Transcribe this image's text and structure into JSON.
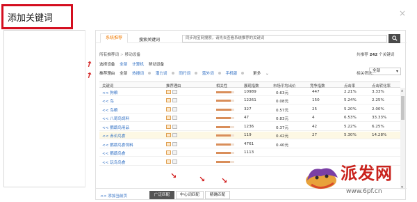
{
  "dialog": {
    "title": "添加关键词",
    "close_glyph": "×"
  },
  "tabs": [
    {
      "label": "系统推荐",
      "active": true
    },
    {
      "label": "搜索关键词",
      "active": false
    }
  ],
  "search": {
    "placeholder": "同步淘宝网搜索，请先去查看系统推荐的关键词",
    "button_icon": "search-icon"
  },
  "breadcrumb": {
    "root": "所有推荐词",
    "current": "移动设备"
  },
  "total_text": {
    "prefix": "共推荐",
    "count": "242",
    "suffix": "个关键词"
  },
  "filters": {
    "device_label": "选择设备",
    "device_options": [
      "全部",
      "计算机",
      "移动设备"
    ],
    "reason_label": "推荐理由",
    "reason_options": [
      "全部",
      "热搜词",
      "潜力词",
      "同行词",
      "蓝外词",
      "手机版"
    ],
    "more_label": "更多",
    "relevance_label": "相关筛选：",
    "relevance_value": "全部"
  },
  "table": {
    "headers": [
      "关键词",
      "推荐理由",
      "相关性",
      "展现指数",
      "市场平均出价",
      "竞争指数",
      "点击率",
      "点击转化率"
    ],
    "rows": [
      {
        "keyword": "<< 狗粮",
        "relevance": 0.85,
        "impressions": "10989",
        "avg_bid": "0.63元",
        "competition": "447",
        "ctr": "2.21%",
        "cvr": "3.33%",
        "highlight": false
      },
      {
        "keyword": "<< 鸟",
        "relevance": 0.8,
        "impressions": "12261",
        "avg_bid": "0.08元",
        "competition": "150",
        "ctr": "5.24%",
        "cvr": "2.25%",
        "highlight": false
      },
      {
        "keyword": "<< 鸟粮",
        "relevance": 0.85,
        "impressions": "327",
        "avg_bid": "0.57元",
        "competition": "25",
        "ctr": "5.20%",
        "cvr": "2.00%",
        "highlight": false
      },
      {
        "keyword": "<< 八哥鸟饲料",
        "relevance": 0.8,
        "impressions": "47",
        "avg_bid": "0.83元",
        "competition": "4",
        "ctr": "6.53%",
        "cvr": "33.33%",
        "highlight": false
      },
      {
        "keyword": "<< 鹦鹉鸟用品",
        "relevance": 0.75,
        "impressions": "1236",
        "avg_bid": "0.37元",
        "competition": "42",
        "ctr": "5.22%",
        "cvr": "6.25%",
        "highlight": false
      },
      {
        "keyword": "<< 赤讥鸟食",
        "relevance": 0.8,
        "impressions": "119",
        "avg_bid": "0.42元",
        "competition": "27",
        "ctr": "5.30%",
        "cvr": "14.28%",
        "highlight": true
      },
      {
        "keyword": "<< 鹦鹉鸟食饲料",
        "relevance": 0.8,
        "impressions": "4761",
        "avg_bid": "0.40元",
        "competition": "",
        "ctr": "",
        "cvr": "",
        "highlight": false
      },
      {
        "keyword": "<< 鹦鹉鸟食",
        "relevance": 0.8,
        "impressions": "1113",
        "avg_bid": "",
        "competition": "",
        "ctr": "",
        "cvr": "",
        "highlight": false
      },
      {
        "keyword": "<< 玩鸟鸟食",
        "relevance": 0.75,
        "impressions": "",
        "avg_bid": "",
        "competition": "",
        "ctr": "",
        "cvr": "",
        "highlight": false
      }
    ]
  },
  "footer": {
    "add_all": "<< 添加当前页",
    "match_buttons": [
      {
        "label": "广泛匹配",
        "active": true
      },
      {
        "label": "中心词匹配",
        "active": false
      },
      {
        "label": "精确匹配",
        "active": false
      }
    ]
  },
  "watermark": {
    "text": "派发网",
    "url": "www.6pf.cn"
  },
  "colors": {
    "highlight_border": "#d40e1f",
    "accent": "#f07a00",
    "link": "#2b6cc2"
  }
}
